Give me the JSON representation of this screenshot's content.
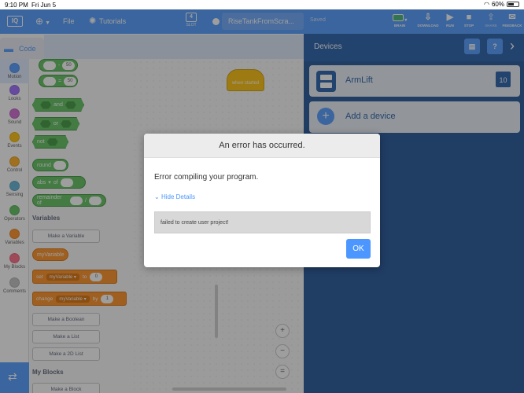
{
  "status_bar": {
    "time": "9:10 PM",
    "date": "Fri Jun 5",
    "battery": "60%",
    "battery_level": 0.6
  },
  "topnav": {
    "logo": "IQ",
    "file": "File",
    "tutorials": "Tutorials",
    "slot_label": "SLOT",
    "slot_number": "4",
    "project_name": "RiseTankFromScra...",
    "saved": "Saved",
    "tools": {
      "brain": "BRAIN",
      "download": "DOWNLOAD",
      "run": "RUN",
      "stop": "STOP",
      "share": "SHARE",
      "feedback": "FEEDBACK"
    }
  },
  "code_tab": "Code",
  "categories": [
    "Motion",
    "Looks",
    "Sound",
    "Events",
    "Control",
    "Sensing",
    "Operators",
    "Variables",
    "My Blocks",
    "Comments"
  ],
  "category_colors": [
    "#4c97ff",
    "#9966ff",
    "#cf63cf",
    "#ffbf00",
    "#ffab19",
    "#5cb1d6",
    "#59c059",
    "#ff8c1a",
    "#ff6680",
    "#bfbfbf"
  ],
  "palette": {
    "op_values": [
      "50",
      "50"
    ],
    "and": "and",
    "or": "or",
    "not": "not",
    "round": "round",
    "abs": "abs",
    "of": "of",
    "remainder": "remainder of",
    "variables_title": "Variables",
    "make_variable": "Make a Variable",
    "my_variable": "myVariable",
    "set": "set",
    "to": "to",
    "set_value": "0",
    "change": "change",
    "by": "by",
    "change_value": "1",
    "make_boolean": "Make a Boolean",
    "make_list": "Make a List",
    "make_2d_list": "Make a 2D List",
    "my_blocks_title": "My Blocks",
    "make_block": "Make a Block"
  },
  "workspace": {
    "hat_block": "when started"
  },
  "devices": {
    "title": "Devices",
    "items": [
      {
        "name": "ArmLift",
        "port": "10"
      }
    ],
    "add_device": "Add a device"
  },
  "modal": {
    "title": "An error has occurred.",
    "message": "Error compiling your program.",
    "details_toggle": "Hide Details",
    "details_text": "failed to create user project!",
    "ok": "OK"
  }
}
